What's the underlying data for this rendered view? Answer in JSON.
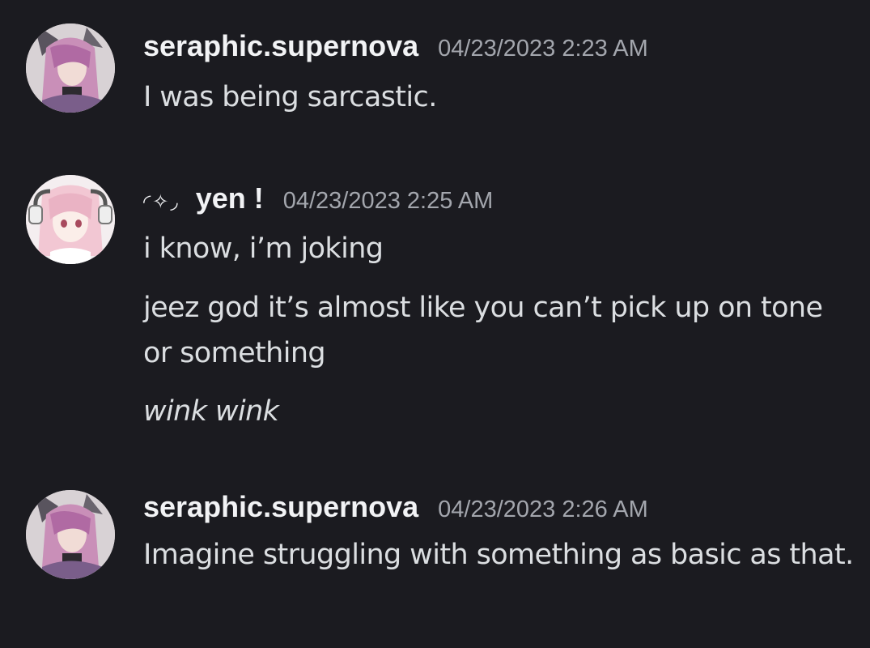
{
  "messages": [
    {
      "author": "seraphic.supernova",
      "timestamp": "04/23/2023 2:23 AM",
      "lines": [
        "I was being sarcastic."
      ]
    },
    {
      "author_decoration": "◜✧◞",
      "author": "yen !",
      "timestamp": "04/23/2023 2:25 AM",
      "lines": [
        "i know, i’m joking",
        "jeez god it’s almost like you can’t pick up on tone or something",
        "wink wink"
      ]
    },
    {
      "author": "seraphic.supernova",
      "timestamp": "04/23/2023 2:26 AM",
      "lines": [
        "Imagine struggling with something as basic as that."
      ]
    }
  ],
  "colors": {
    "background": "#1b1b20",
    "username": "#f2f3f5",
    "timestamp": "#a3a6ad",
    "text": "#dbdee1"
  }
}
